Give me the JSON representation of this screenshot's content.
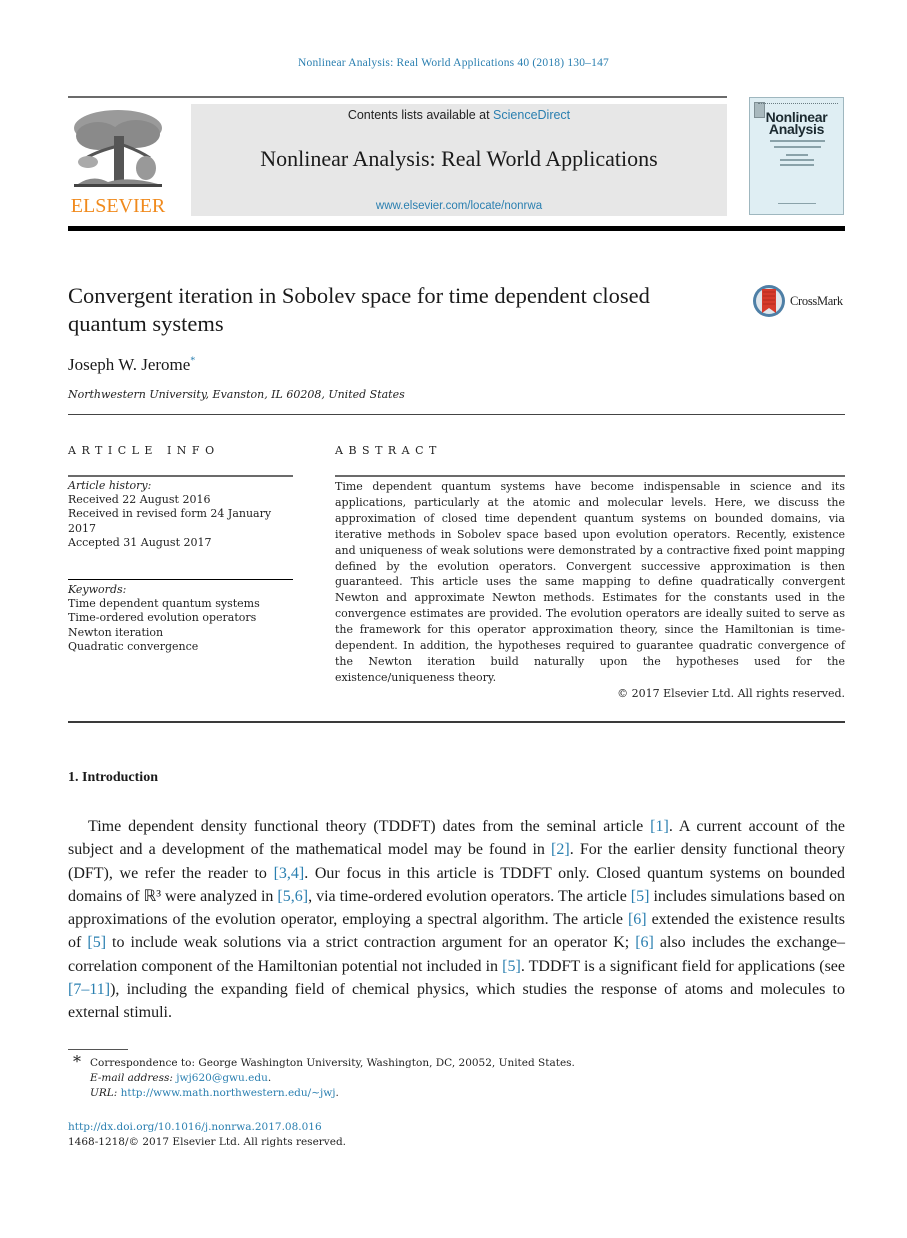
{
  "journal_ref": "Nonlinear Analysis: Real World Applications 40 (2018) 130–147",
  "header": {
    "publisher_wordmark": "ELSEVIER",
    "contents_prefix": "Contents lists available at ",
    "contents_link": "ScienceDirect",
    "journal_title": "Nonlinear Analysis: Real World Applications",
    "journal_url": "www.elsevier.com/locate/nonrwa",
    "cover_title_line1": "Nonlinear",
    "cover_title_line2": "Analysis"
  },
  "article": {
    "title": "Convergent iteration in Sobolev space for time dependent closed quantum systems",
    "crossmark_label": "CrossMark",
    "author": "Joseph W. Jerome",
    "author_mark": "*",
    "affiliation": "Northwestern University, Evanston, IL 60208, United States"
  },
  "article_info": {
    "heading": "ARTICLE INFO",
    "history_heading": "Article history:",
    "history": [
      "Received 22 August 2016",
      "Received in revised form 24 January 2017",
      "Accepted 31 August 2017"
    ],
    "keywords_heading": "Keywords:",
    "keywords": [
      "Time dependent quantum systems",
      "Time-ordered evolution operators",
      "Newton iteration",
      "Quadratic convergence"
    ]
  },
  "abstract": {
    "heading": "ABSTRACT",
    "text": "Time dependent quantum systems have become indispensable in science and its applications, particularly at the atomic and molecular levels. Here, we discuss the approximation of closed time dependent quantum systems on bounded domains, via iterative methods in Sobolev space based upon evolution operators. Recently, existence and uniqueness of weak solutions were demonstrated by a contractive fixed point mapping defined by the evolution operators. Convergent successive approximation is then guaranteed. This article uses the same mapping to define quadratically convergent Newton and approximate Newton methods. Estimates for the constants used in the convergence estimates are provided. The evolution operators are ideally suited to serve as the framework for this operator approximation theory, since the Hamiltonian is time-dependent. In addition, the hypotheses required to guarantee quadratic convergence of the Newton iteration build naturally upon the hypotheses used for the existence/uniqueness theory.",
    "copyright": "© 2017 Elsevier Ltd. All rights reserved."
  },
  "introduction": {
    "heading": "1.  Introduction",
    "segments": [
      {
        "t": "Time dependent density functional theory (TDDFT) dates from the seminal article ",
        "ref": false
      },
      {
        "t": "[1]",
        "ref": true
      },
      {
        "t": ". A current account of the subject and a development of the mathematical model may be found in ",
        "ref": false
      },
      {
        "t": "[2]",
        "ref": true
      },
      {
        "t": ". For the earlier density functional theory (DFT), we refer the reader to ",
        "ref": false
      },
      {
        "t": "[3,4]",
        "ref": true
      },
      {
        "t": ". Our focus in this article is TDDFT only. Closed quantum systems on bounded domains of ℝ³ were analyzed in ",
        "ref": false
      },
      {
        "t": "[5,6]",
        "ref": true
      },
      {
        "t": ", via time-ordered evolution operators. The article ",
        "ref": false
      },
      {
        "t": "[5]",
        "ref": true
      },
      {
        "t": " includes simulations based on approximations of the evolution operator, employing a spectral algorithm. The article ",
        "ref": false
      },
      {
        "t": "[6]",
        "ref": true
      },
      {
        "t": " extended the existence results of ",
        "ref": false
      },
      {
        "t": "[5]",
        "ref": true
      },
      {
        "t": " to include weak solutions via a strict contraction argument for an operator K; ",
        "ref": false
      },
      {
        "t": "[6]",
        "ref": true
      },
      {
        "t": " also includes the exchange–correlation component of the Hamiltonian potential not included in ",
        "ref": false
      },
      {
        "t": "[5]",
        "ref": true
      },
      {
        "t": ". TDDFT is a significant field for applications (see ",
        "ref": false
      },
      {
        "t": "[7–11]",
        "ref": true
      },
      {
        "t": "), including the expanding field of chemical physics, which studies the response of atoms and molecules to external stimuli.",
        "ref": false
      }
    ]
  },
  "footnotes": {
    "star": "*",
    "correspondence": "Correspondence to: George Washington University, Washington, DC, 20052, United States.",
    "email_label": "E-mail address:",
    "email": "jwj620@gwu.edu",
    "url_label": "URL:",
    "url": "http://www.math.northwestern.edu/∼jwj",
    "doi": "http://dx.doi.org/10.1016/j.nonrwa.2017.08.016",
    "issn_copyright": "1468-1218/© 2017 Elsevier Ltd. All rights reserved."
  },
  "colors": {
    "link": "#2a7fb0",
    "elsevier_orange": "#f08a1d",
    "banner_gray": "#e7e7e7",
    "cover_blue": "#dfeef3"
  }
}
